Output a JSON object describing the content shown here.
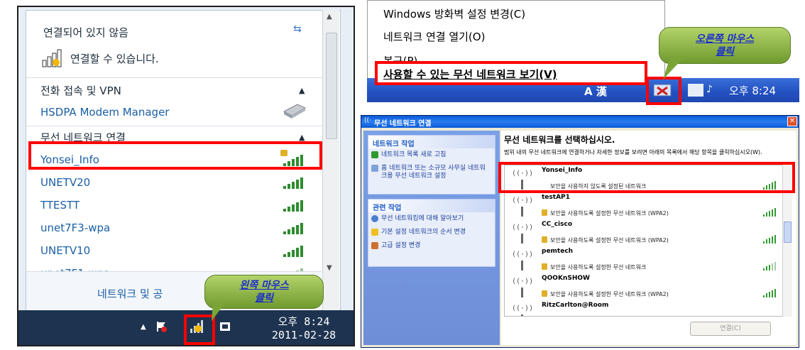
{
  "win7": {
    "status_title": "연결되어 있지 않음",
    "status_sub": "연결할 수 있습니다.",
    "section_dialup": "전화 접속 및 VPN",
    "dialup_item": "HSDPA Modem Manager",
    "section_wireless": "무선 네트워크 연결",
    "networks": [
      {
        "name": "Yonsei_Info"
      },
      {
        "name": "UNETV20"
      },
      {
        "name": "TTESTT"
      },
      {
        "name": "unet7F3-wpa"
      },
      {
        "name": "UNETV10"
      },
      {
        "name": "unet7F1-wpa"
      }
    ],
    "footer_link": "네트워크 및 공",
    "clock_time": "오후 8:24",
    "clock_date": "2011-02-28"
  },
  "xp_menu": {
    "items": [
      "Windows 방화벽 설정 변경(C)",
      "네트워크 연결 열기(O)",
      "복구(P)",
      "사용할 수 있는 무선 네트워크 보기(V)"
    ],
    "taskbar_lang": "A 漢",
    "taskbar_time": "오후 8:24"
  },
  "xp_dialog": {
    "title": "무선 네트워크 연결",
    "tasks_head": "네트워크 작업",
    "tasks": [
      "네트워크 목록 새로 고침",
      "홈 네트워크 또는 소규모 사무실 네트워크용 무선 네트워크 설정"
    ],
    "related_head": "관련 작업",
    "related": [
      "무선 네트워킹에 대해 알아보기",
      "기본 설정 네트워크의 순서 변경",
      "고급 설정 변경"
    ],
    "main_title": "무선 네트워크를 선택하십시오.",
    "main_desc": "범위 내의 무선 네트워크에 연결하거나 자세한 정보를 보려면 아래의 목록에서 해당 항목을 클릭하십시오(W).",
    "networks": [
      {
        "name": "Yonsei_Info",
        "security": "보안을 사용하지 않도록 설정된 네트워크"
      },
      {
        "name": "testAP1",
        "security": "보안을 사용하도록 설정한 무선 네트워크 (WPA2)"
      },
      {
        "name": "CC_cisco",
        "security": "보안을 사용하도록 설정한 무선 네트워크 (WPA2)"
      },
      {
        "name": "pemtech",
        "security": "보안을 사용하도록 설정한 무선 네트워크"
      },
      {
        "name": "QOOKnSHOW",
        "security": "보안을 사용하도록 설정한 무선 네트워크 (WPA2)"
      },
      {
        "name": "RitzCarlton@Room",
        "security": ""
      }
    ],
    "connect_button": "연결(C)"
  },
  "callouts": {
    "left_click": [
      "왼쪽 마우스",
      "클릭"
    ],
    "right_click": [
      "오른쪽 마우스",
      "클릭"
    ]
  },
  "colors": {
    "highlight": "#ff0000",
    "callout": "#8fb847",
    "xp_blue": "#2452c2",
    "link_blue": "#1b5fa6"
  }
}
